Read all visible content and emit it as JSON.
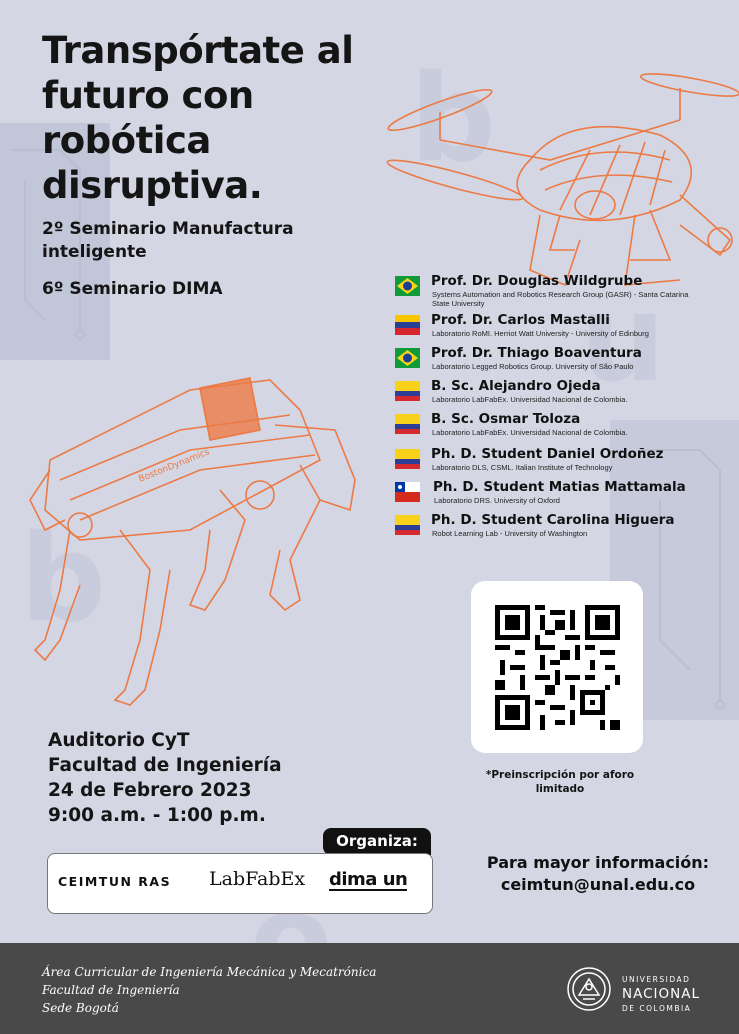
{
  "title": "Transpórtate al futuro con robótica disruptiva.",
  "subtitles": {
    "seminar1": "2º Seminario Manufactura inteligente",
    "seminar2": "6º Seminario DIMA"
  },
  "speakers": [
    {
      "name": "Prof. Dr. Douglas Wildgrube",
      "affiliation": "Systems Automation and Robotics Research Group (GASR) - Santa Catarina State University",
      "flag": "brazil"
    },
    {
      "name": "Prof. Dr. Carlos Mastalli",
      "affiliation": "Laboratorio RoMI. Herriot Watt University - University of Edinburg",
      "flag": "venezuela"
    },
    {
      "name": "Prof. Dr. Thiago Boaventura",
      "affiliation": "Laboratorio Legged Robotics Group. University of São Paulo",
      "flag": "brazil"
    },
    {
      "name": "B. Sc. Alejandro Ojeda",
      "affiliation": "Laboratorio LabFabEx. Universidad Nacional de Colombia.",
      "flag": "colombia"
    },
    {
      "name": "B. Sc. Osmar Toloza",
      "affiliation": "Laboratorio LabFabEx. Universidad Nacional de Colombia.",
      "flag": "colombia"
    },
    {
      "name": "Ph. D. Student Daniel Ordoñez",
      "affiliation": "Laboratorio DLS, CSML. Italian Institute of Technology",
      "flag": "colombia"
    },
    {
      "name": "Ph. D. Student Matias Mattamala",
      "affiliation": "Laboratorio DRS. University of Oxford",
      "flag": "chile"
    },
    {
      "name": "Ph. D. Student Carolina Higuera",
      "affiliation": "Robot Learning Lab - University of Washington",
      "flag": "colombia"
    }
  ],
  "venue": {
    "line1": "Auditorio CyT",
    "line2": "Facultad de Ingeniería",
    "line3": "24 de Febrero 2023",
    "line4": "9:00 a.m. - 1:00 p.m."
  },
  "qr_note": "*Preinscripción por aforo limitado",
  "organiza": {
    "label": "Organiza:",
    "logos": [
      "CEIMTUN RAS",
      "LabFabEx",
      "dima un"
    ]
  },
  "contact": {
    "line1": "Para mayor información:",
    "line2": "ceimtun@unal.edu.co"
  },
  "footer": {
    "line1": "Área Curricular de Ingeniería Mecánica y Mecatrónica",
    "line2": "Facultad de Ingeniería",
    "line3": "Sede Bogotá",
    "university_small1": "UNIVERSIDAD",
    "university_big": "NACIONAL",
    "university_small2": "DE COLOMBIA"
  },
  "colors": {
    "background": "#d4d6e4",
    "accent_orange": "#ec7a45",
    "text": "#151515",
    "footer": "#494949"
  }
}
